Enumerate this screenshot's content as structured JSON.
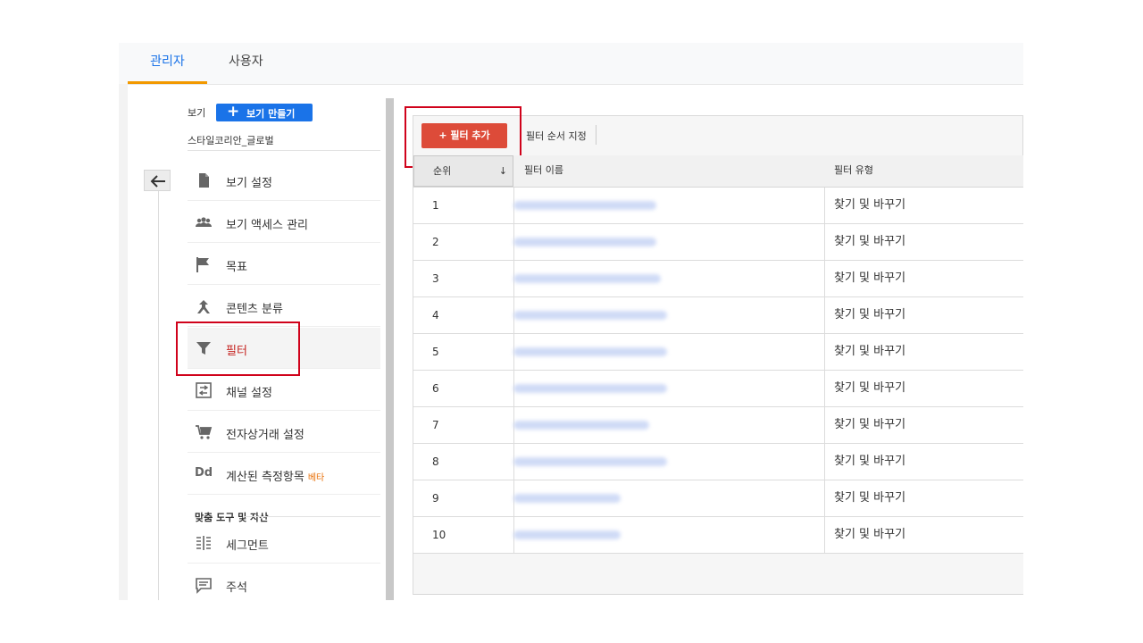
{
  "tabs": [
    {
      "label": "관리자",
      "active": true
    },
    {
      "label": "사용자",
      "active": false
    }
  ],
  "view": {
    "label": "보기",
    "create_button": "보기 만들기",
    "name": "스타일코리안_글로벌"
  },
  "menu": [
    {
      "label": "보기 설정",
      "icon": "document-icon"
    },
    {
      "label": "보기 액세스 관리",
      "icon": "people-icon"
    },
    {
      "label": "목표",
      "icon": "flag-icon"
    },
    {
      "label": "콘텐츠 분류",
      "icon": "content-grouping-icon"
    },
    {
      "label": "필터",
      "icon": "filter-icon",
      "active": true
    },
    {
      "label": "채널 설정",
      "icon": "channel-icon"
    },
    {
      "label": "전자상거래 설정",
      "icon": "cart-icon"
    },
    {
      "label": "계산된 측정항목",
      "icon": "calculated-metric-icon",
      "badge": "베타"
    }
  ],
  "section_title": "맞춤 도구 및 자산",
  "tools": [
    {
      "label": "세그먼트",
      "icon": "segment-icon"
    },
    {
      "label": "주석",
      "icon": "annotation-icon"
    }
  ],
  "toolbar": {
    "add_filter": "+ 필터 추가",
    "order_filter": "필터 순서 지정"
  },
  "table": {
    "headers": {
      "rank": "순위",
      "name": "필터 이름",
      "type": "필터 유형"
    },
    "rows": [
      {
        "rank": "1",
        "type": "찾기 및 바꾸기"
      },
      {
        "rank": "2",
        "type": "찾기 및 바꾸기"
      },
      {
        "rank": "3",
        "type": "찾기 및 바꾸기"
      },
      {
        "rank": "4",
        "type": "찾기 및 바꾸기"
      },
      {
        "rank": "5",
        "type": "찾기 및 바꾸기"
      },
      {
        "rank": "6",
        "type": "찾기 및 바꾸기"
      },
      {
        "rank": "7",
        "type": "찾기 및 바꾸기"
      },
      {
        "rank": "8",
        "type": "찾기 및 바꾸기"
      },
      {
        "rank": "9",
        "type": "찾기 및 바꾸기"
      },
      {
        "rank": "10",
        "type": "찾기 및 바꾸기"
      }
    ]
  },
  "colors": {
    "accent_blue": "#1a73e8",
    "tab_underline": "#f29900",
    "add_button": "#dd4b39",
    "highlight_box": "#d0021b",
    "active_text": "#c5221f"
  }
}
